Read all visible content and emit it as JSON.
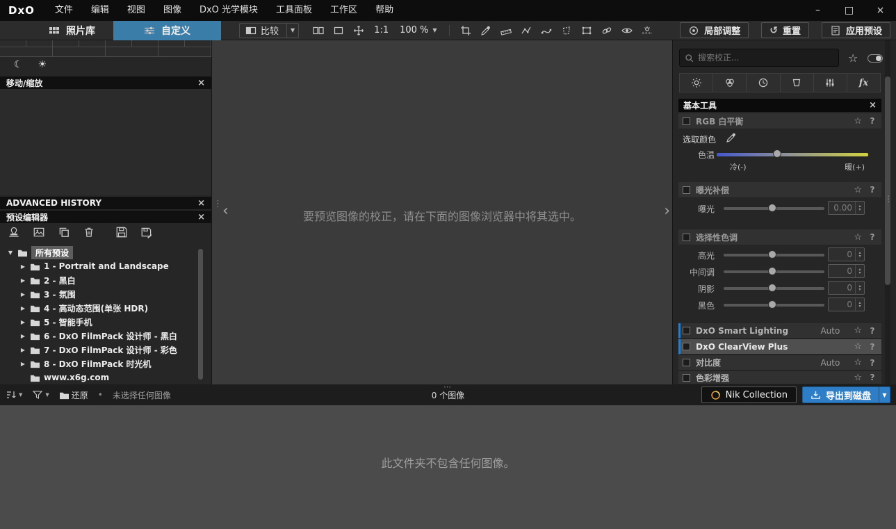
{
  "colors": {
    "active_tab_blue": "#3a7da8",
    "accent_blue": "#2f7cc0",
    "export_button_blue": "#2d7ec6",
    "temp_gradient_left": "#4558cc",
    "temp_gradient_right": "#d2d23e"
  },
  "icons": {
    "minimize": "–",
    "maximize": "□",
    "close_window": "×",
    "close": "×",
    "star": "☆",
    "moon": "☾",
    "sun": "☀",
    "dropdown": "▼",
    "tree_expanded": "▼",
    "tree_collapsed": "▶",
    "chevron_left": "‹",
    "chevron_right": "›",
    "dots_vertical": "⋮",
    "dots_horizontal": "⋯",
    "bullet": "•",
    "spin_up": "▴",
    "spin_down": "▾",
    "reset": "↺",
    "fx": "fx"
  },
  "titlebar": {
    "logo": "DxO",
    "menus": [
      "文件",
      "编辑",
      "视图",
      "图像",
      "DxO 光学模块",
      "工具面板",
      "工作区",
      "帮助"
    ]
  },
  "toolbar": {
    "photo_library": "照片库",
    "customize": "自定义",
    "compare": "比较",
    "one_to_one": "1:1",
    "zoom_level": "100 %",
    "local_adjustments": "局部调整",
    "reset": "重置",
    "apply_preset": "应用预设"
  },
  "left_panel": {
    "move_zoom_title": "移动/缩放",
    "advanced_history_title": "ADVANCED HISTORY",
    "preset_editor_title": "预设编辑器",
    "tree_root": "所有预设",
    "tree_items": [
      "1 - Portrait and Landscape",
      "2 - 黑白",
      "3 - 氛围",
      "4 - 高动态范围(单张 HDR)",
      "5 - 智能手机",
      "6 - DxO FilmPack 设计师 - 黑白",
      "7 - DxO FilmPack 设计师 - 彩色",
      "8 - DxO FilmPack 时光机",
      "www.x6g.com"
    ]
  },
  "viewer": {
    "placeholder": "要预览图像的校正，请在下面的图像浏览器中将其选中。"
  },
  "right_panel": {
    "search_placeholder": "搜索校正...",
    "palette_title": "基本工具",
    "help": "?",
    "white_balance": {
      "title": "RGB 白平衡",
      "pick_color": "选取颜色",
      "temperature": "色温",
      "cold": "冷(-)",
      "warm": "暖(+)"
    },
    "exposure": {
      "title": "曝光补偿",
      "label": "曝光",
      "value": "0.00"
    },
    "selective_tone": {
      "title": "选择性色调",
      "rows": [
        {
          "label": "高光",
          "value": "0"
        },
        {
          "label": "中间调",
          "value": "0"
        },
        {
          "label": "阴影",
          "value": "0"
        },
        {
          "label": "黑色",
          "value": "0"
        }
      ]
    },
    "smart_lighting": {
      "title": "DxO Smart Lighting",
      "mode": "Auto"
    },
    "clearview": {
      "title": "DxO ClearView Plus",
      "mode": ""
    },
    "contrast": {
      "title": "对比度",
      "mode": "Auto"
    },
    "color_rendering": {
      "title": "色彩增强",
      "mode": ""
    }
  },
  "bottom_bar": {
    "restore": "还原",
    "selection_status": "未选择任何图像",
    "image_count": "0 个图像",
    "nik_collection": "Nik Collection",
    "export_to_disk": "导出到磁盘"
  },
  "browser": {
    "empty_message": "此文件夹不包含任何图像。"
  }
}
